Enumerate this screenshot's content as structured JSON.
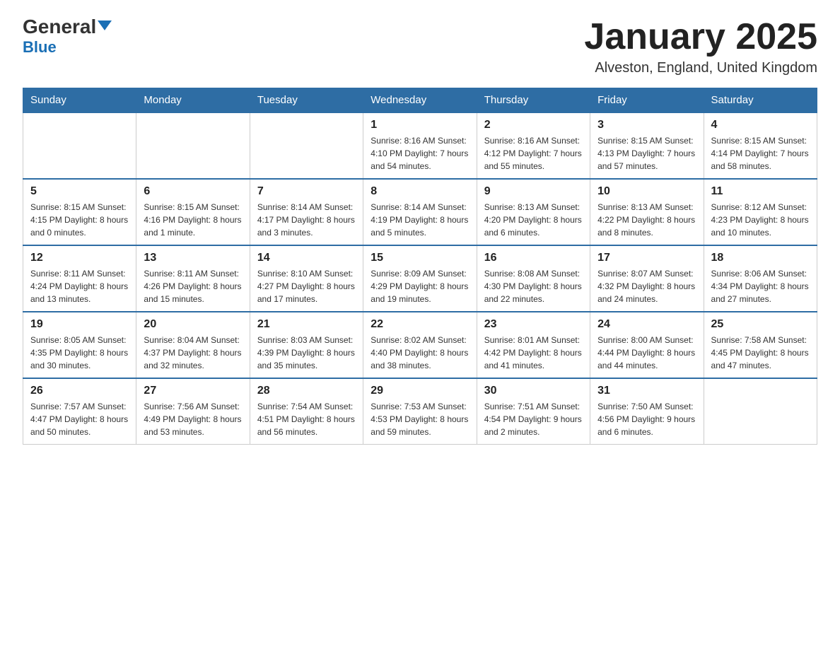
{
  "header": {
    "logo_general": "General",
    "logo_blue": "Blue",
    "month_title": "January 2025",
    "location": "Alveston, England, United Kingdom"
  },
  "weekdays": [
    "Sunday",
    "Monday",
    "Tuesday",
    "Wednesday",
    "Thursday",
    "Friday",
    "Saturday"
  ],
  "weeks": [
    [
      {
        "day": "",
        "info": ""
      },
      {
        "day": "",
        "info": ""
      },
      {
        "day": "",
        "info": ""
      },
      {
        "day": "1",
        "info": "Sunrise: 8:16 AM\nSunset: 4:10 PM\nDaylight: 7 hours\nand 54 minutes."
      },
      {
        "day": "2",
        "info": "Sunrise: 8:16 AM\nSunset: 4:12 PM\nDaylight: 7 hours\nand 55 minutes."
      },
      {
        "day": "3",
        "info": "Sunrise: 8:15 AM\nSunset: 4:13 PM\nDaylight: 7 hours\nand 57 minutes."
      },
      {
        "day": "4",
        "info": "Sunrise: 8:15 AM\nSunset: 4:14 PM\nDaylight: 7 hours\nand 58 minutes."
      }
    ],
    [
      {
        "day": "5",
        "info": "Sunrise: 8:15 AM\nSunset: 4:15 PM\nDaylight: 8 hours\nand 0 minutes."
      },
      {
        "day": "6",
        "info": "Sunrise: 8:15 AM\nSunset: 4:16 PM\nDaylight: 8 hours\nand 1 minute."
      },
      {
        "day": "7",
        "info": "Sunrise: 8:14 AM\nSunset: 4:17 PM\nDaylight: 8 hours\nand 3 minutes."
      },
      {
        "day": "8",
        "info": "Sunrise: 8:14 AM\nSunset: 4:19 PM\nDaylight: 8 hours\nand 5 minutes."
      },
      {
        "day": "9",
        "info": "Sunrise: 8:13 AM\nSunset: 4:20 PM\nDaylight: 8 hours\nand 6 minutes."
      },
      {
        "day": "10",
        "info": "Sunrise: 8:13 AM\nSunset: 4:22 PM\nDaylight: 8 hours\nand 8 minutes."
      },
      {
        "day": "11",
        "info": "Sunrise: 8:12 AM\nSunset: 4:23 PM\nDaylight: 8 hours\nand 10 minutes."
      }
    ],
    [
      {
        "day": "12",
        "info": "Sunrise: 8:11 AM\nSunset: 4:24 PM\nDaylight: 8 hours\nand 13 minutes."
      },
      {
        "day": "13",
        "info": "Sunrise: 8:11 AM\nSunset: 4:26 PM\nDaylight: 8 hours\nand 15 minutes."
      },
      {
        "day": "14",
        "info": "Sunrise: 8:10 AM\nSunset: 4:27 PM\nDaylight: 8 hours\nand 17 minutes."
      },
      {
        "day": "15",
        "info": "Sunrise: 8:09 AM\nSunset: 4:29 PM\nDaylight: 8 hours\nand 19 minutes."
      },
      {
        "day": "16",
        "info": "Sunrise: 8:08 AM\nSunset: 4:30 PM\nDaylight: 8 hours\nand 22 minutes."
      },
      {
        "day": "17",
        "info": "Sunrise: 8:07 AM\nSunset: 4:32 PM\nDaylight: 8 hours\nand 24 minutes."
      },
      {
        "day": "18",
        "info": "Sunrise: 8:06 AM\nSunset: 4:34 PM\nDaylight: 8 hours\nand 27 minutes."
      }
    ],
    [
      {
        "day": "19",
        "info": "Sunrise: 8:05 AM\nSunset: 4:35 PM\nDaylight: 8 hours\nand 30 minutes."
      },
      {
        "day": "20",
        "info": "Sunrise: 8:04 AM\nSunset: 4:37 PM\nDaylight: 8 hours\nand 32 minutes."
      },
      {
        "day": "21",
        "info": "Sunrise: 8:03 AM\nSunset: 4:39 PM\nDaylight: 8 hours\nand 35 minutes."
      },
      {
        "day": "22",
        "info": "Sunrise: 8:02 AM\nSunset: 4:40 PM\nDaylight: 8 hours\nand 38 minutes."
      },
      {
        "day": "23",
        "info": "Sunrise: 8:01 AM\nSunset: 4:42 PM\nDaylight: 8 hours\nand 41 minutes."
      },
      {
        "day": "24",
        "info": "Sunrise: 8:00 AM\nSunset: 4:44 PM\nDaylight: 8 hours\nand 44 minutes."
      },
      {
        "day": "25",
        "info": "Sunrise: 7:58 AM\nSunset: 4:45 PM\nDaylight: 8 hours\nand 47 minutes."
      }
    ],
    [
      {
        "day": "26",
        "info": "Sunrise: 7:57 AM\nSunset: 4:47 PM\nDaylight: 8 hours\nand 50 minutes."
      },
      {
        "day": "27",
        "info": "Sunrise: 7:56 AM\nSunset: 4:49 PM\nDaylight: 8 hours\nand 53 minutes."
      },
      {
        "day": "28",
        "info": "Sunrise: 7:54 AM\nSunset: 4:51 PM\nDaylight: 8 hours\nand 56 minutes."
      },
      {
        "day": "29",
        "info": "Sunrise: 7:53 AM\nSunset: 4:53 PM\nDaylight: 8 hours\nand 59 minutes."
      },
      {
        "day": "30",
        "info": "Sunrise: 7:51 AM\nSunset: 4:54 PM\nDaylight: 9 hours\nand 2 minutes."
      },
      {
        "day": "31",
        "info": "Sunrise: 7:50 AM\nSunset: 4:56 PM\nDaylight: 9 hours\nand 6 minutes."
      },
      {
        "day": "",
        "info": ""
      }
    ]
  ]
}
